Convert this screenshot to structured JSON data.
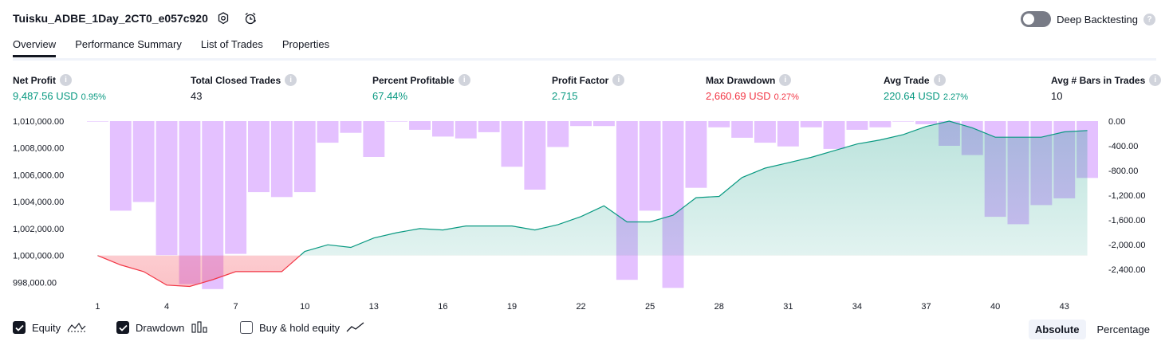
{
  "header": {
    "title": "Tuisku_ADBE_1Day_2CT0_e057c920",
    "settings_icon": "gear-icon",
    "alert_icon": "alarm-clock-icon",
    "deep_backtesting_label": "Deep Backtesting",
    "deep_backtesting_on": false
  },
  "tabs": [
    {
      "label": "Overview",
      "active": true
    },
    {
      "label": "Performance Summary",
      "active": false
    },
    {
      "label": "List of Trades",
      "active": false
    },
    {
      "label": "Properties",
      "active": false
    }
  ],
  "stats": [
    {
      "label": "Net Profit",
      "value": "9,487.56 USD",
      "pct": "0.95%",
      "color": "green"
    },
    {
      "label": "Total Closed Trades",
      "value": "43",
      "pct": "",
      "color": "dark"
    },
    {
      "label": "Percent Profitable",
      "value": "67.44%",
      "pct": "",
      "color": "green"
    },
    {
      "label": "Profit Factor",
      "value": "2.715",
      "pct": "",
      "color": "green"
    },
    {
      "label": "Max Drawdown",
      "value": "2,660.69 USD",
      "pct": "0.27%",
      "color": "red"
    },
    {
      "label": "Avg Trade",
      "value": "220.64 USD",
      "pct": "2.27%",
      "color": "green"
    },
    {
      "label": "Avg # Bars in Trades",
      "value": "10",
      "pct": "",
      "color": "dark"
    }
  ],
  "chart_data": {
    "type": "line",
    "x": [
      1,
      2,
      3,
      4,
      5,
      6,
      7,
      8,
      9,
      10,
      11,
      12,
      13,
      14,
      15,
      16,
      17,
      18,
      19,
      20,
      21,
      22,
      23,
      24,
      25,
      26,
      27,
      28,
      29,
      30,
      31,
      32,
      33,
      34,
      35,
      36,
      37,
      38,
      39,
      40,
      41,
      42,
      43,
      44
    ],
    "x_ticks": [
      "1",
      "4",
      "7",
      "10",
      "13",
      "16",
      "19",
      "22",
      "25",
      "28",
      "31",
      "34",
      "37",
      "40",
      "43"
    ],
    "left_axis_ticks": [
      "1,010,000.00",
      "1,008,000.00",
      "1,006,000.00",
      "1,004,000.00",
      "1,002,000.00",
      "1,000,000.00",
      "998,000.00"
    ],
    "right_axis_ticks": [
      "0.00",
      "-400.00",
      "-800.00",
      "-1,200.00",
      "-1,600.00",
      "-2,000.00",
      "-2,400.00"
    ],
    "ylim_left": [
      997400,
      1010100
    ],
    "ylim_right": [
      -2660,
      10
    ],
    "series": [
      {
        "name": "Equity",
        "color_up": "#089981",
        "color_down": "#f23645",
        "baseline": 1000000,
        "values": [
          1000000,
          999300,
          998800,
          997800,
          997700,
          998200,
          998800,
          998800,
          998800,
          1000300,
          1000800,
          1000600,
          1001300,
          1001700,
          1002000,
          1001900,
          1002200,
          1002200,
          1002200,
          1001900,
          1002300,
          1002900,
          1003700,
          1002500,
          1002500,
          1003000,
          1004300,
          1004400,
          1005800,
          1006500,
          1006900,
          1007300,
          1007800,
          1008300,
          1008600,
          1009000,
          1009600,
          1010000,
          1009500,
          1008800,
          1008800,
          1008800,
          1009200,
          1009300
        ]
      },
      {
        "name": "Drawdown",
        "color": "#c77dff",
        "values": [
          0,
          -1450,
          -1310,
          -2170,
          -2640,
          -2720,
          -2150,
          -1150,
          -1230,
          -1150,
          -350,
          -190,
          -580,
          0,
          -140,
          -250,
          -280,
          -180,
          -740,
          -1110,
          -420,
          -80,
          -80,
          -2570,
          -1450,
          -2700,
          -1080,
          -100,
          -270,
          -350,
          -410,
          -100,
          -450,
          -140,
          -100,
          0,
          -50,
          -400,
          -550,
          -1550,
          -1670,
          -1360,
          -1250,
          -920
        ]
      }
    ]
  },
  "legend": [
    {
      "label": "Equity",
      "checked": true,
      "icon": "equity-line-icon"
    },
    {
      "label": "Drawdown",
      "checked": true,
      "icon": "drawdown-bars-icon"
    },
    {
      "label": "Buy & hold equity",
      "checked": false,
      "icon": "buy-hold-line-icon"
    }
  ],
  "scale_modes": [
    {
      "label": "Absolute",
      "active": true
    },
    {
      "label": "Percentage",
      "active": false
    }
  ]
}
